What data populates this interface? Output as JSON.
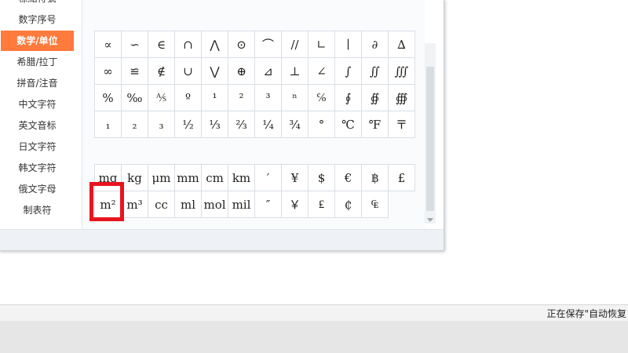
{
  "categories": [
    {
      "label": "標點符號"
    },
    {
      "label": "数字序号"
    },
    {
      "label": "数学/单位",
      "active": true
    },
    {
      "label": "希腊/拉丁"
    },
    {
      "label": "拼音/注音"
    },
    {
      "label": "中文字符"
    },
    {
      "label": "英文音标"
    },
    {
      "label": "日文字符"
    },
    {
      "label": "韩文字符"
    },
    {
      "label": "俄文字母"
    },
    {
      "label": "制表符"
    }
  ],
  "math_symbols": [
    [
      "∝",
      "∽",
      "∈",
      "∩",
      "⋀",
      "⊙",
      "⌒",
      "//",
      "∟",
      "∣",
      "∂",
      "∆"
    ],
    [
      "∞",
      "≌",
      "∉",
      "∪",
      "⋁",
      "⊕",
      "⊿",
      "⊥",
      "∠",
      "∫",
      "∬",
      "∭"
    ],
    [
      "%",
      "‰",
      "⅍",
      "º",
      "¹",
      "²",
      "³",
      "ⁿ",
      "℅",
      "∮",
      "∯",
      "∰"
    ],
    [
      "₁",
      "₂",
      "₃",
      "½",
      "⅓",
      "⅔",
      "¼",
      "¾",
      "°",
      "℃",
      "℉",
      "〒"
    ]
  ],
  "unit_symbols": [
    [
      "mg",
      "kg",
      "μm",
      "mm",
      "cm",
      "km",
      "′",
      "¥",
      "$",
      "€",
      "฿",
      "£"
    ],
    [
      "m²",
      "m³",
      "cc",
      "ml",
      "mol",
      "mil",
      "″",
      "￥",
      "₤",
      "₵",
      "₠"
    ]
  ],
  "status": {
    "text": "正在保存\"自动恢复"
  }
}
